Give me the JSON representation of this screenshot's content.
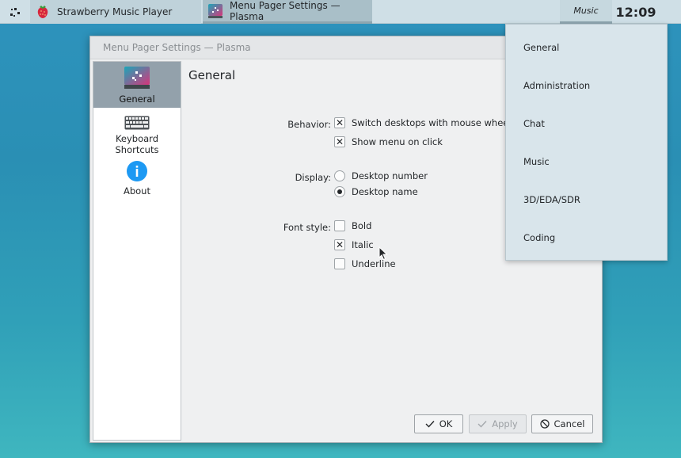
{
  "taskbar": {
    "tasks": [
      {
        "label": "Strawberry Music Player",
        "icon": "strawberry-icon"
      },
      {
        "label": "Menu Pager Settings — Plasma",
        "icon": "menu-pager-icon"
      }
    ],
    "tray_music": "Music",
    "clock": "12:09"
  },
  "window": {
    "title": "Menu Pager Settings — Plasma",
    "sidebar": [
      {
        "label": "General",
        "icon": "menu-pager-icon",
        "selected": true
      },
      {
        "label": "Keyboard Shortcuts",
        "line1": "Keyboard",
        "line2": "Shortcuts",
        "icon": "keyboard-icon"
      },
      {
        "label": "About",
        "icon": "info-icon"
      }
    ],
    "page_title": "General",
    "behavior": {
      "label": "Behavior:",
      "options": [
        {
          "label": "Switch desktops with mouse wheel",
          "checked": true
        },
        {
          "label": "Show menu on click",
          "checked": true
        }
      ]
    },
    "display": {
      "label": "Display:",
      "options": [
        {
          "label": "Desktop number",
          "selected": false
        },
        {
          "label": "Desktop name",
          "selected": true
        }
      ]
    },
    "font_style": {
      "label": "Font style:",
      "options": [
        {
          "label": "Bold",
          "checked": false
        },
        {
          "label": "Italic",
          "checked": true
        },
        {
          "label": "Underline",
          "checked": false
        }
      ]
    },
    "buttons": {
      "ok": "OK",
      "apply": "Apply",
      "cancel": "Cancel"
    }
  },
  "popup_menu": {
    "items": [
      "General",
      "Administration",
      "Chat",
      "Music",
      "3D/EDA/SDR",
      "Coding"
    ]
  },
  "colors": {
    "taskbar": "#cfdfe6",
    "sidebar_selected": "#93a1ab",
    "popup_bg": "#d9e5eb",
    "desktop": "#2e93bd"
  }
}
